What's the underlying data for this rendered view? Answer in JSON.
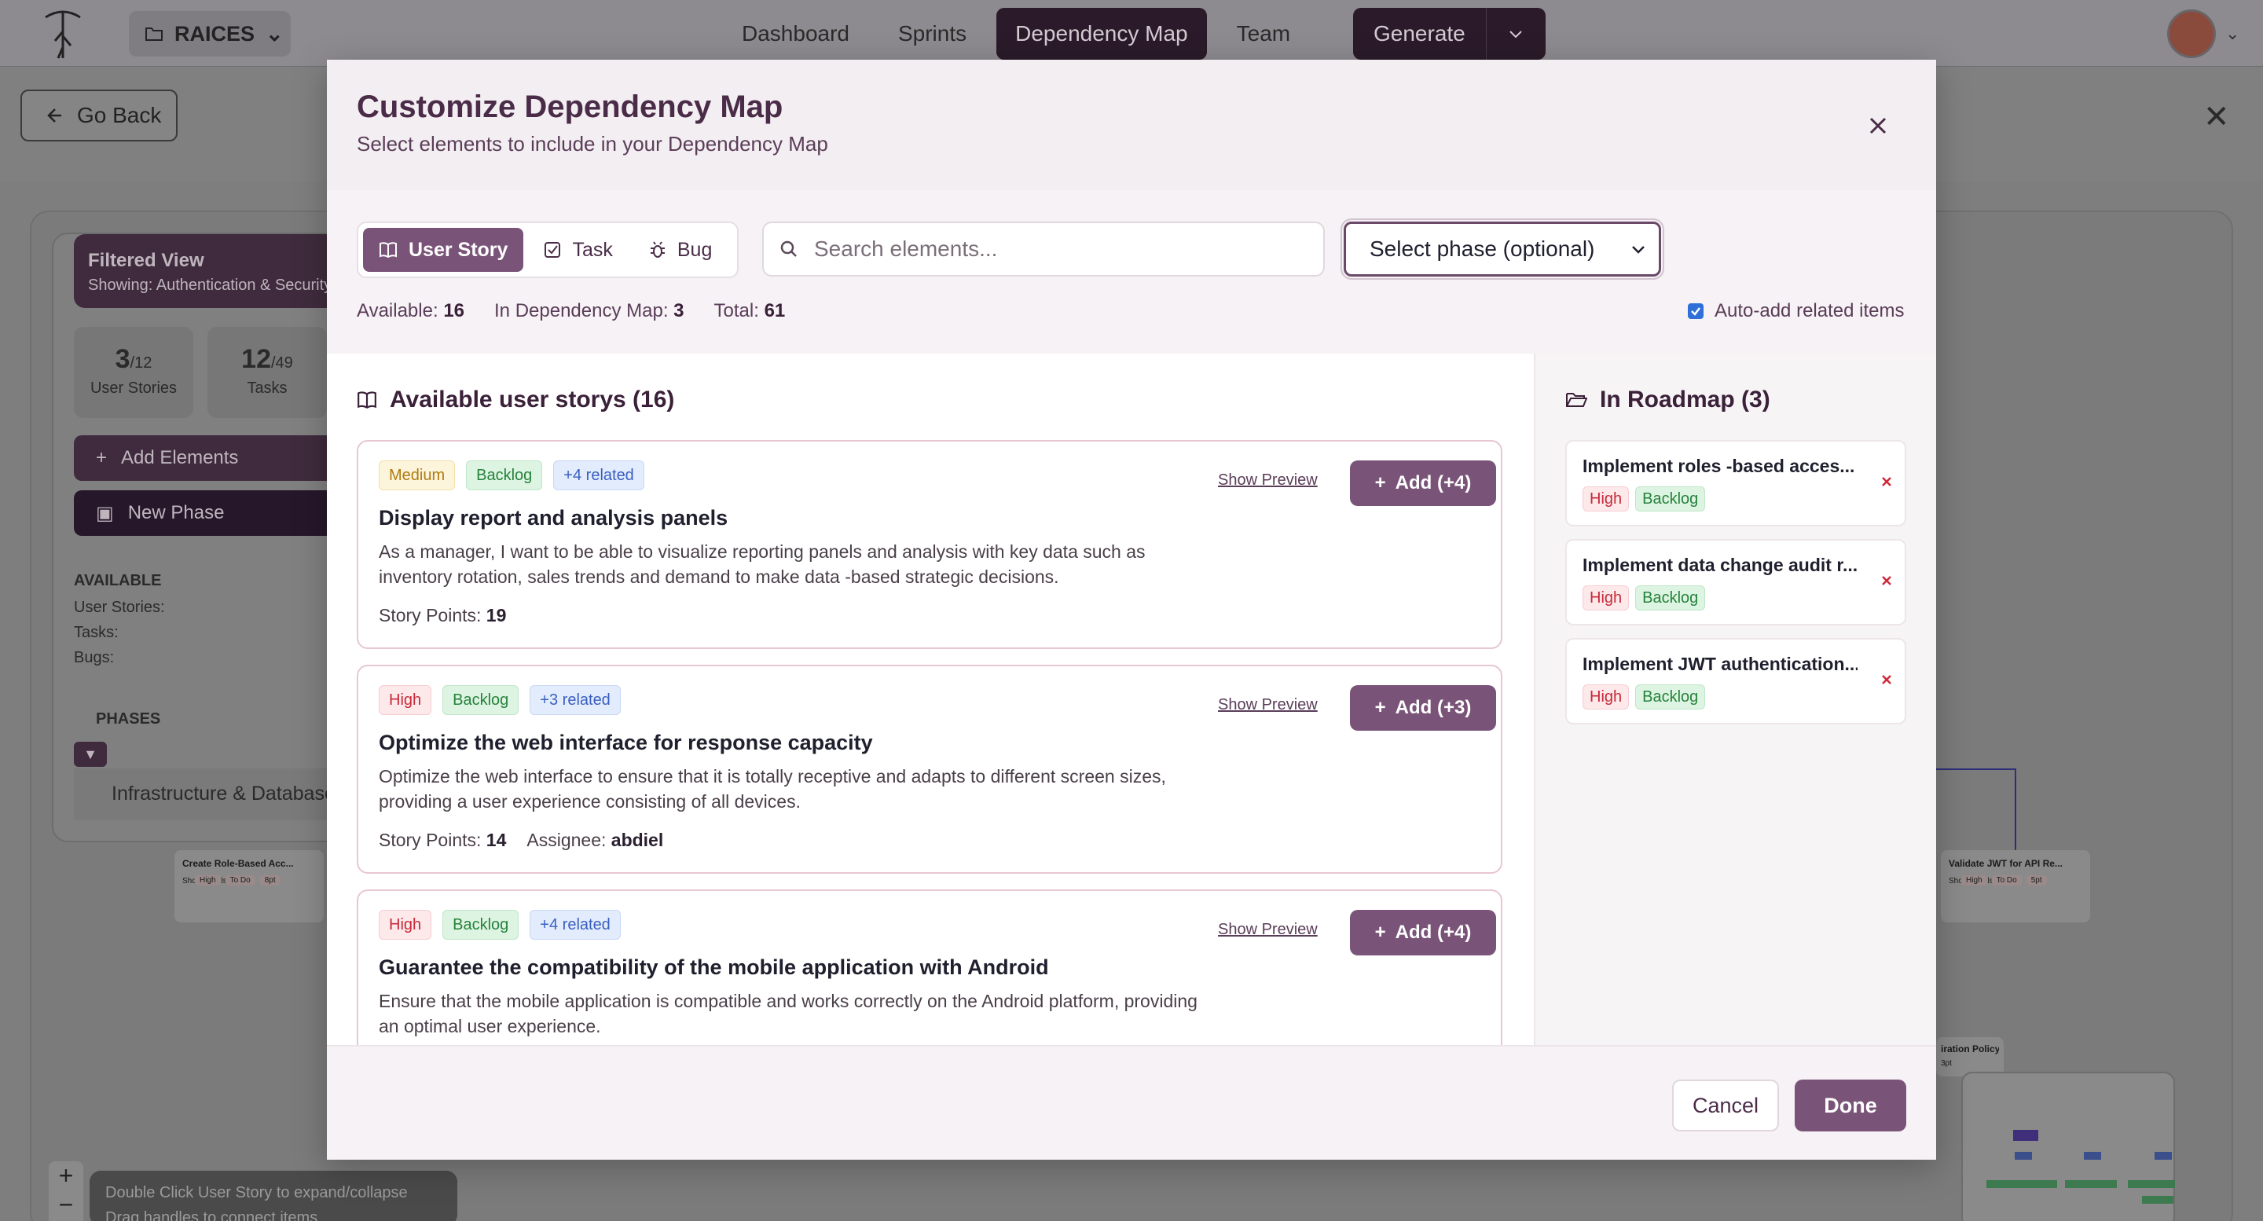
{
  "app": {
    "project_name": "RAICES",
    "nav": [
      "Dashboard",
      "Sprints",
      "Dependency Map",
      "Team"
    ],
    "generate_label": "Generate",
    "go_back_label": "Go Back"
  },
  "background": {
    "filtered_view_title": "Filtered View",
    "filtered_view_sub": "Showing: Authentication & Security",
    "stats": [
      {
        "value": "3",
        "total": "/12",
        "label": "User Stories"
      },
      {
        "value": "12",
        "total": "/49",
        "label": "Tasks"
      }
    ],
    "add_elements_label": "Add Elements",
    "new_phase_label": "New Phase",
    "available_head": "AVAILABLE",
    "available_rows": [
      "User Stories:",
      "Tasks:",
      "Bugs:"
    ],
    "phases_head": "PHASES",
    "phase_name": "Infrastructure & Database",
    "mini_cards": [
      {
        "title": "Create Role-Based Acc...",
        "priority": "High",
        "status": "To Do",
        "points": "8pt",
        "details": "Show details"
      },
      {
        "title": "Validate JWT for API Re...",
        "priority": "High",
        "status": "To Do",
        "points": "5pt",
        "details": "Show details"
      }
    ],
    "mini_card_partial": {
      "title": "iration Policy",
      "points": "3pt"
    },
    "hints": [
      "Double Click User Story to expand/collapse",
      "Drag handles to connect items"
    ]
  },
  "modal": {
    "title": "Customize Dependency Map",
    "subtitle": "Select elements to include in your Dependency Map",
    "tabs": [
      {
        "label": "User Story",
        "icon": "book-icon",
        "active": true
      },
      {
        "label": "Task",
        "icon": "checkbox-icon",
        "active": false
      },
      {
        "label": "Bug",
        "icon": "bug-icon",
        "active": false
      }
    ],
    "search_placeholder": "Search elements...",
    "phase_select": "Select phase (optional)",
    "counts": {
      "available_label": "Available:",
      "available": "16",
      "in_map_label": "In Dependency Map:",
      "in_map": "3",
      "total_label": "Total:",
      "total": "61"
    },
    "auto_add_label": "Auto-add related items",
    "auto_add_checked": true,
    "available_title": "Available user storys (16)",
    "show_preview_label": "Show Preview",
    "story_points_label": "Story Points:",
    "assignee_label": "Assignee:",
    "items": [
      {
        "priority": "Medium",
        "status": "Backlog",
        "related": "+4 related",
        "title": "Display report and analysis panels",
        "description": "As a manager, I want to be able to visualize reporting panels and analysis with key data such as inventory rotation, sales trends and demand to make data -based strategic decisions.",
        "points": "19",
        "assignee": "",
        "add_label": "Add (+4)"
      },
      {
        "priority": "High",
        "status": "Backlog",
        "related": "+3 related",
        "title": "Optimize the web interface for response capacity",
        "description": "Optimize the web interface to ensure that it is totally receptive and adapts to different screen sizes, providing a user experience consisting of all devices.",
        "points": "14",
        "assignee": "abdiel",
        "add_label": "Add (+3)"
      },
      {
        "priority": "High",
        "status": "Backlog",
        "related": "+4 related",
        "title": "Guarantee the compatibility of the mobile application with Android",
        "description": "Ensure that the mobile application is compatible and works correctly on the Android platform, providing an optimal user experience.",
        "points": "",
        "assignee": "",
        "add_label": "Add (+4)"
      }
    ],
    "roadmap_title": "In Roadmap (3)",
    "roadmap": [
      {
        "title": "Implement roles -based acces...",
        "priority": "High",
        "status": "Backlog"
      },
      {
        "title": "Implement data change audit r...",
        "priority": "High",
        "status": "Backlog"
      },
      {
        "title": "Implement JWT authentication...",
        "priority": "High",
        "status": "Backlog"
      }
    ],
    "cancel_label": "Cancel",
    "done_label": "Done"
  },
  "colors": {
    "accent": "#7a5478",
    "title": "#4a2c48",
    "high": "#c62b3a",
    "backlog": "#27823c",
    "related": "#3a5fc0"
  }
}
